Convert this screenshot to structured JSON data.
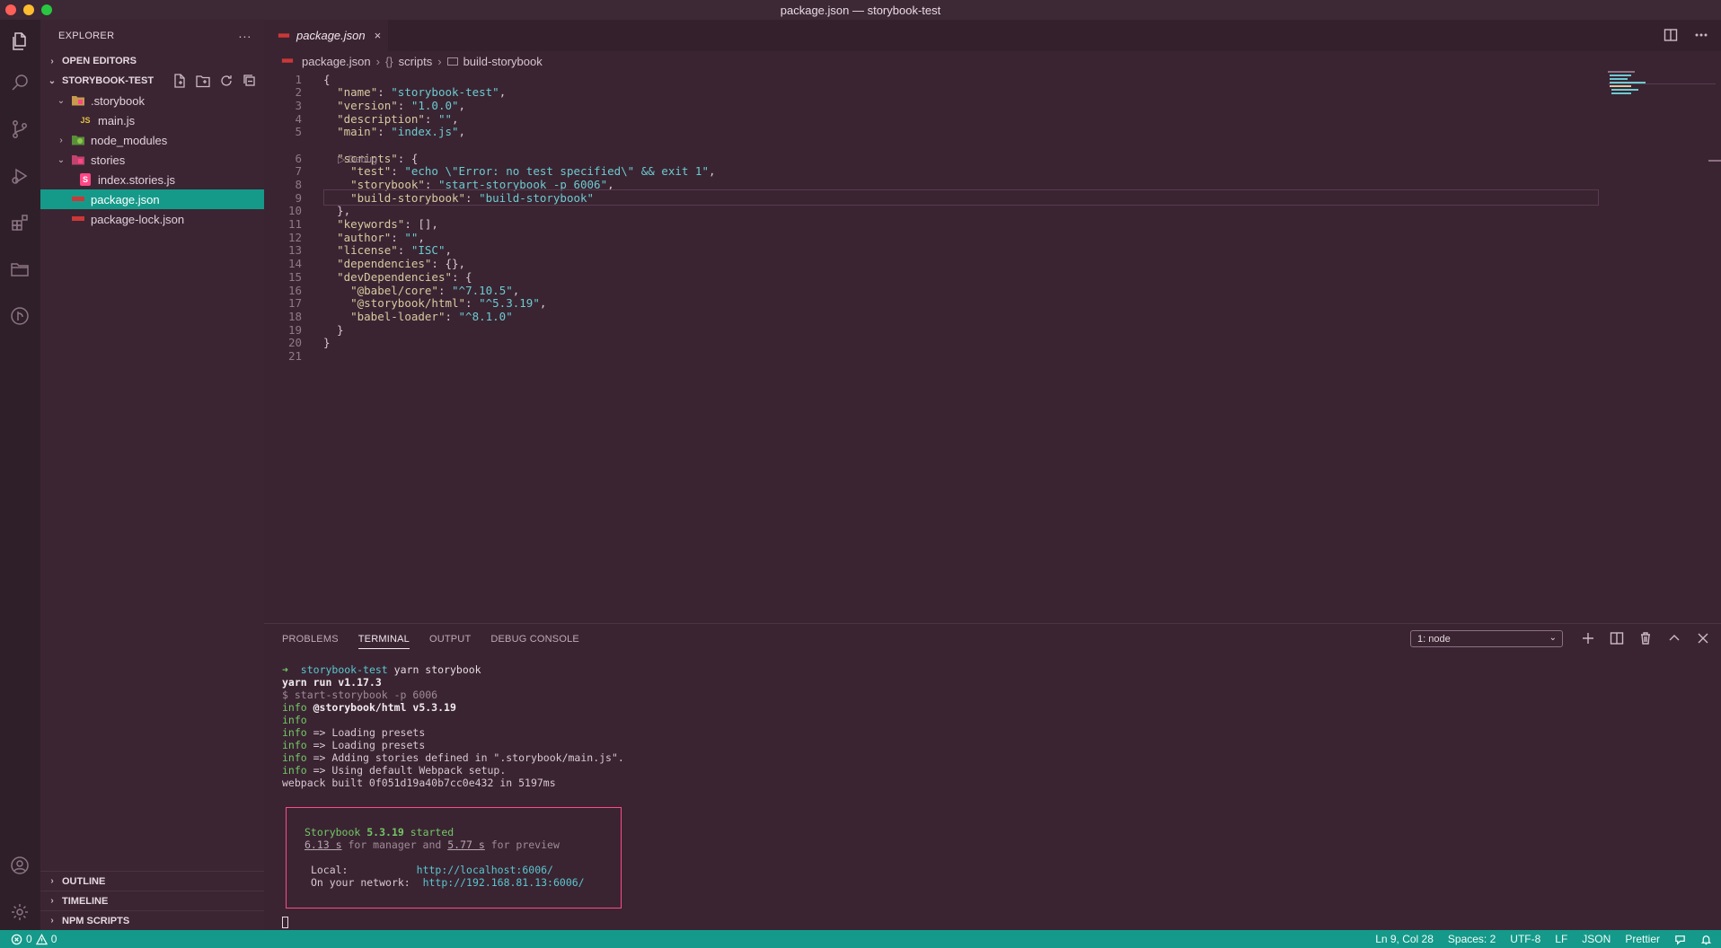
{
  "window": {
    "title": "package.json — storybook-test"
  },
  "colors": {
    "accent": "#14998a",
    "selection": "#159a8a",
    "box_border": "#ff4a86",
    "string": "#6ccbd0",
    "key": "#d9c9a0",
    "prompt": "#73c765"
  },
  "activity_bar": [
    "files-icon",
    "search-icon",
    "source-control-icon",
    "run-debug-icon",
    "extensions-icon",
    "folder-icon",
    "git-graph-icon",
    "account-icon",
    "settings-gear-icon"
  ],
  "explorer": {
    "header": "EXPLORER",
    "open_editors": "OPEN EDITORS",
    "project": "STORYBOOK-TEST",
    "tree": [
      {
        "label": ".storybook",
        "icon": "folder-storybook-icon",
        "chev": "⌄"
      },
      {
        "label": "main.js",
        "icon": "js-file-icon",
        "badge": "JS"
      },
      {
        "label": "node_modules",
        "icon": "folder-node-icon",
        "chev": "›"
      },
      {
        "label": "stories",
        "icon": "folder-stories-icon",
        "chev": "⌄"
      },
      {
        "label": "index.stories.js",
        "icon": "storybook-file-icon",
        "badge": "S"
      },
      {
        "label": "package.json",
        "icon": "npm-file-icon"
      },
      {
        "label": "package-lock.json",
        "icon": "npm-file-icon"
      }
    ],
    "outline": "OUTLINE",
    "timeline": "TIMELINE",
    "npm_scripts": "NPM SCRIPTS"
  },
  "editor": {
    "tab_label": "package.json",
    "tab_close": "×",
    "breadcrumb": {
      "file": "package.json",
      "sym_icon": "{}",
      "scripts": "scripts",
      "leaf": "build-storybook"
    },
    "codelens": "▷ Debug",
    "lines": [
      {
        "n": "1",
        "parts": [
          [
            "p",
            "{"
          ]
        ]
      },
      {
        "n": "2",
        "parts": [
          [
            "p",
            "  "
          ],
          [
            "k",
            "\"name\""
          ],
          [
            "p",
            ": "
          ],
          [
            "s",
            "\"storybook-test\""
          ],
          [
            "p",
            ","
          ]
        ]
      },
      {
        "n": "3",
        "parts": [
          [
            "p",
            "  "
          ],
          [
            "k",
            "\"version\""
          ],
          [
            "p",
            ": "
          ],
          [
            "s",
            "\"1.0.0\""
          ],
          [
            "p",
            ","
          ]
        ]
      },
      {
        "n": "4",
        "parts": [
          [
            "p",
            "  "
          ],
          [
            "k",
            "\"description\""
          ],
          [
            "p",
            ": "
          ],
          [
            "s",
            "\"\""
          ],
          [
            "p",
            ","
          ]
        ]
      },
      {
        "n": "5",
        "parts": [
          [
            "p",
            "  "
          ],
          [
            "k",
            "\"main\""
          ],
          [
            "p",
            ": "
          ],
          [
            "s",
            "\"index.js\""
          ],
          [
            "p",
            ","
          ]
        ]
      },
      {
        "n": "6",
        "parts": [
          [
            "p",
            "  "
          ],
          [
            "k",
            "\"scripts\""
          ],
          [
            "p",
            ": {"
          ]
        ]
      },
      {
        "n": "7",
        "parts": [
          [
            "p",
            "    "
          ],
          [
            "k",
            "\"test\""
          ],
          [
            "p",
            ": "
          ],
          [
            "s",
            "\"echo \\\"Error: no test specified\\\" && exit 1\""
          ],
          [
            "p",
            ","
          ]
        ]
      },
      {
        "n": "8",
        "parts": [
          [
            "p",
            "    "
          ],
          [
            "k",
            "\"storybook\""
          ],
          [
            "p",
            ": "
          ],
          [
            "s",
            "\"start-storybook -p 6006\""
          ],
          [
            "p",
            ","
          ]
        ]
      },
      {
        "n": "9",
        "parts": [
          [
            "p",
            "    "
          ],
          [
            "k",
            "\"build-storybook\""
          ],
          [
            "p",
            ": "
          ],
          [
            "s",
            "\"build-storybook\""
          ]
        ]
      },
      {
        "n": "10",
        "parts": [
          [
            "p",
            "  },"
          ]
        ]
      },
      {
        "n": "11",
        "parts": [
          [
            "p",
            "  "
          ],
          [
            "k",
            "\"keywords\""
          ],
          [
            "p",
            ": [],"
          ]
        ]
      },
      {
        "n": "12",
        "parts": [
          [
            "p",
            "  "
          ],
          [
            "k",
            "\"author\""
          ],
          [
            "p",
            ": "
          ],
          [
            "s",
            "\"\""
          ],
          [
            "p",
            ","
          ]
        ]
      },
      {
        "n": "13",
        "parts": [
          [
            "p",
            "  "
          ],
          [
            "k",
            "\"license\""
          ],
          [
            "p",
            ": "
          ],
          [
            "s",
            "\"ISC\""
          ],
          [
            "p",
            ","
          ]
        ]
      },
      {
        "n": "14",
        "parts": [
          [
            "p",
            "  "
          ],
          [
            "k",
            "\"dependencies\""
          ],
          [
            "p",
            ": {},"
          ]
        ]
      },
      {
        "n": "15",
        "parts": [
          [
            "p",
            "  "
          ],
          [
            "k",
            "\"devDependencies\""
          ],
          [
            "p",
            ": {"
          ]
        ]
      },
      {
        "n": "16",
        "parts": [
          [
            "p",
            "    "
          ],
          [
            "k",
            "\"@babel/core\""
          ],
          [
            "p",
            ": "
          ],
          [
            "s",
            "\"^7.10.5\""
          ],
          [
            "p",
            ","
          ]
        ]
      },
      {
        "n": "17",
        "parts": [
          [
            "p",
            "    "
          ],
          [
            "k",
            "\"@storybook/html\""
          ],
          [
            "p",
            ": "
          ],
          [
            "s",
            "\"^5.3.19\""
          ],
          [
            "p",
            ","
          ]
        ]
      },
      {
        "n": "18",
        "parts": [
          [
            "p",
            "    "
          ],
          [
            "k",
            "\"babel-loader\""
          ],
          [
            "p",
            ": "
          ],
          [
            "s",
            "\"^8.1.0\""
          ]
        ]
      },
      {
        "n": "19",
        "parts": [
          [
            "p",
            "  }"
          ]
        ]
      },
      {
        "n": "20",
        "parts": [
          [
            "p",
            "}"
          ]
        ]
      },
      {
        "n": "21",
        "parts": []
      }
    ]
  },
  "panel": {
    "tabs": [
      "PROBLEMS",
      "TERMINAL",
      "OUTPUT",
      "DEBUG CONSOLE"
    ],
    "terminal_select": "1: node",
    "terminal": {
      "prompt_arrow": "➜",
      "prompt_dir": "storybook-test",
      "prompt_cmd": "yarn storybook",
      "lines": [
        [
          [
            "b",
            "yarn run v1.17.3"
          ]
        ],
        [
          [
            "dim",
            "$ start-storybook -p 6006"
          ]
        ],
        [
          [
            "g",
            "info"
          ],
          [
            "b",
            " @storybook/html v5.3.19"
          ]
        ],
        [
          [
            "g",
            "info"
          ]
        ],
        [
          [
            "g",
            "info"
          ],
          [
            "p",
            " => Loading presets"
          ]
        ],
        [
          [
            "g",
            "info"
          ],
          [
            "p",
            " => Loading presets"
          ]
        ],
        [
          [
            "g",
            "info"
          ],
          [
            "p",
            " => Adding stories defined in \".storybook/main.js\"."
          ]
        ],
        [
          [
            "g",
            "info"
          ],
          [
            "p",
            " => Using default Webpack setup."
          ]
        ],
        [
          [
            "p",
            "webpack built 0f051d19a40b7cc0e432 in 5197ms"
          ]
        ]
      ],
      "box": {
        "started": [
          [
            "g",
            "Storybook "
          ],
          [
            "gb",
            "5.3.19"
          ],
          [
            "g",
            " started"
          ]
        ],
        "timing": [
          [
            "u",
            "6.13 s"
          ],
          [
            "dim",
            " for manager and "
          ],
          [
            "u",
            "5.77 s"
          ],
          [
            "dim",
            " for preview"
          ]
        ],
        "local_label": "Local:",
        "local_url": "http://localhost:6006/",
        "network_label": "On your network:",
        "network_url": "http://192.168.81.13:6006/"
      }
    }
  },
  "status_bar": {
    "errors": "0",
    "warnings": "0",
    "position": "Ln 9, Col 28",
    "spaces": "Spaces: 2",
    "encoding": "UTF-8",
    "eol": "LF",
    "language": "JSON",
    "formatter": "Prettier"
  }
}
